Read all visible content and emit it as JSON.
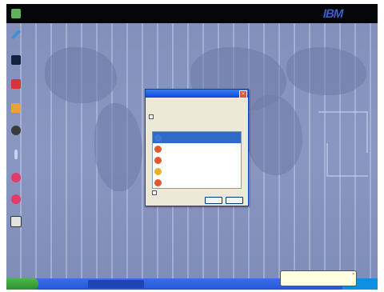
{
  "brand": {
    "logo_text": "IBM"
  },
  "desktop_icons": [
    {
      "name": "recycle-bin-icon",
      "color": "#5fb35f"
    },
    {
      "name": "pen-icon",
      "color": "#3f8fd6"
    },
    {
      "name": "monitor-icon",
      "color": "#12233f"
    },
    {
      "name": "adobe-reader-icon",
      "color": "#d23636"
    },
    {
      "name": "media-icon",
      "color": "#e6a437"
    },
    {
      "name": "user-icon",
      "color": "#3a3a3a"
    },
    {
      "name": "tool-icon",
      "color": "#c9d4ec"
    },
    {
      "name": "ie-shortcut-icon",
      "color": "#e33a6a"
    },
    {
      "name": "network-icon",
      "color": "#e33a6a"
    },
    {
      "name": "connect-icon",
      "color": "#e1e1e1"
    }
  ],
  "dialog": {
    "title": "",
    "intro": "",
    "check_label": "",
    "list_label": "",
    "items": [
      {
        "label": "",
        "sub": "",
        "color": "#3a78d6",
        "selected": true
      },
      {
        "label": "",
        "sub": "",
        "color": "#e05a2a",
        "selected": false
      },
      {
        "label": "",
        "sub": "",
        "color": "#e05a2a",
        "selected": false
      },
      {
        "label": "",
        "sub": "",
        "color": "#e9b030",
        "selected": false
      },
      {
        "label": "",
        "sub": "",
        "color": "#e05a2a",
        "selected": false
      }
    ],
    "bottom_check_label": "",
    "ok_label": "",
    "cancel_label": ""
  },
  "taskbar": {
    "start_label": "",
    "task_item_label": "",
    "tray_text": ""
  },
  "balloon": {
    "text": ""
  }
}
